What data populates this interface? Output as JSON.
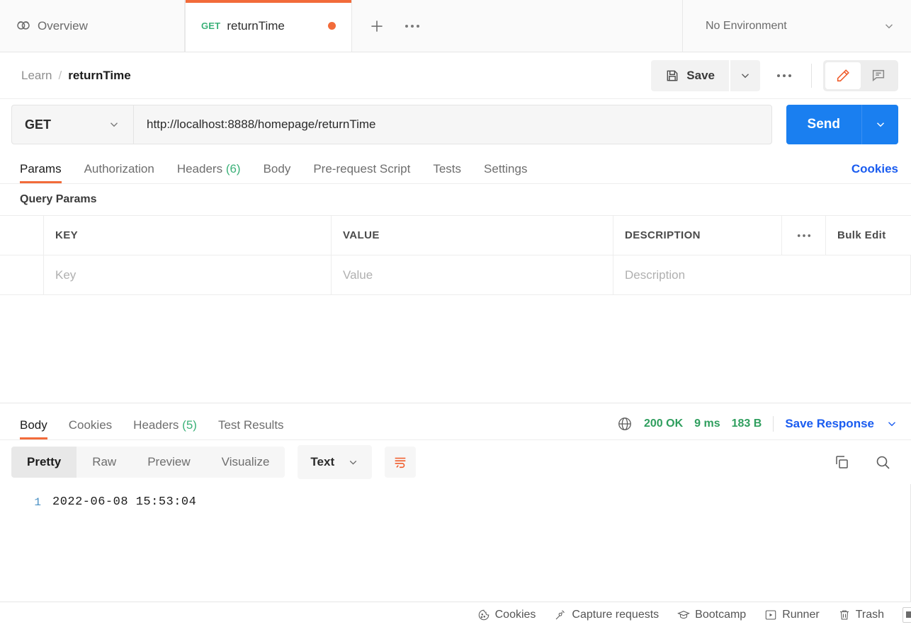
{
  "tabbar": {
    "overview_label": "Overview",
    "request_tab": {
      "method": "GET",
      "name": "returnTime",
      "unsaved": true
    },
    "new_tab_label": "+",
    "more_label": "●●●",
    "environment": {
      "selected": "No Environment"
    }
  },
  "breadcrumb": {
    "collection": "Learn",
    "separator": "/",
    "current": "returnTime",
    "save_label": "Save",
    "more_label": "●●●"
  },
  "request": {
    "method": "GET",
    "url": "http://localhost:8888/homepage/returnTime",
    "send_label": "Send",
    "tabs": [
      {
        "label": "Params",
        "count": "",
        "active": true
      },
      {
        "label": "Authorization",
        "count": "",
        "active": false
      },
      {
        "label": "Headers",
        "count": "(6)",
        "active": false
      },
      {
        "label": "Body",
        "count": "",
        "active": false
      },
      {
        "label": "Pre-request Script",
        "count": "",
        "active": false
      },
      {
        "label": "Tests",
        "count": "",
        "active": false
      },
      {
        "label": "Settings",
        "count": "",
        "active": false
      }
    ],
    "cookies_link": "Cookies"
  },
  "query_params": {
    "title": "Query Params",
    "columns": [
      "KEY",
      "VALUE",
      "DESCRIPTION"
    ],
    "options_label": "●●●",
    "bulk_edit_label": "Bulk Edit",
    "rows": [
      {
        "key_placeholder": "Key",
        "value_placeholder": "Value",
        "description_placeholder": "Description"
      }
    ]
  },
  "response": {
    "tabs": [
      {
        "label": "Body",
        "count": "",
        "active": true
      },
      {
        "label": "Cookies",
        "count": "",
        "active": false
      },
      {
        "label": "Headers",
        "count": "(5)",
        "active": false
      },
      {
        "label": "Test Results",
        "count": "",
        "active": false
      }
    ],
    "status": "200 OK",
    "time": "9 ms",
    "size": "183 B",
    "save_response_label": "Save Response",
    "view_modes": [
      {
        "label": "Pretty",
        "active": true
      },
      {
        "label": "Raw",
        "active": false
      },
      {
        "label": "Preview",
        "active": false
      },
      {
        "label": "Visualize",
        "active": false
      }
    ],
    "format": "Text",
    "body_lines": [
      {
        "number": "1",
        "text": "2022-06-08 15:53:04"
      }
    ]
  },
  "statusbar": {
    "items": [
      {
        "label": "Cookies",
        "icon": "cookie-icon"
      },
      {
        "label": "Capture requests",
        "icon": "satellite-icon"
      },
      {
        "label": "Bootcamp",
        "icon": "graduation-cap-icon"
      },
      {
        "label": "Runner",
        "icon": "runner-play-icon"
      },
      {
        "label": "Trash",
        "icon": "trash-icon"
      }
    ]
  },
  "colors": {
    "accent_orange": "#f26b3a",
    "send_blue": "#1a7ff0",
    "link_blue": "#1a5cf0",
    "status_green": "#2f9e5e",
    "method_green": "#3cb179"
  }
}
